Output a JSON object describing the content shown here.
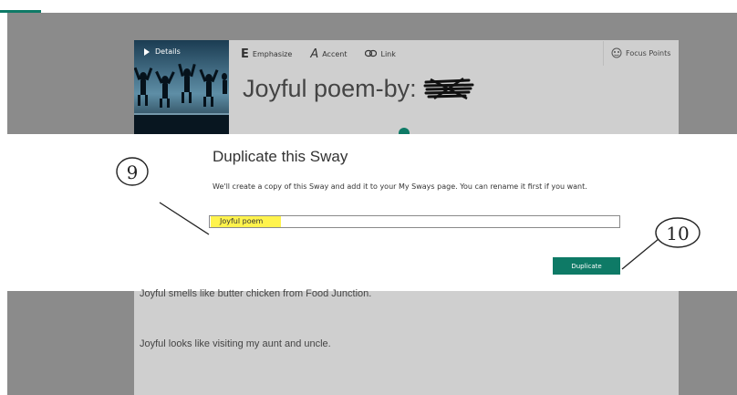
{
  "editor": {
    "details_label": "Details",
    "toolbar": [
      {
        "glyph": "E",
        "label": "Emphasize",
        "icon": "emphasize-icon"
      },
      {
        "glyph": "A",
        "label": "Accent",
        "icon": "accent-icon"
      },
      {
        "glyph": "⚭",
        "label": "Link",
        "icon": "link-icon"
      }
    ],
    "focus_points_label": "Focus Points",
    "headline": "Joyful poem-by:",
    "paragraphs": [
      "Joyful smells like butter chicken from Food Junction.",
      "Joyful looks like visiting my aunt and uncle."
    ]
  },
  "dialog": {
    "title": "Duplicate this Sway",
    "description": "We'll create a copy of this Sway and add it to your My Sways page. You can rename it first if you want.",
    "name_value": "Joyful poem",
    "duplicate_label": "Duplicate"
  },
  "annotations": [
    "9",
    "10"
  ],
  "colors": {
    "accent": "#0e7a66",
    "highlight": "#fff34d",
    "overlay": "#8b8b8b"
  }
}
